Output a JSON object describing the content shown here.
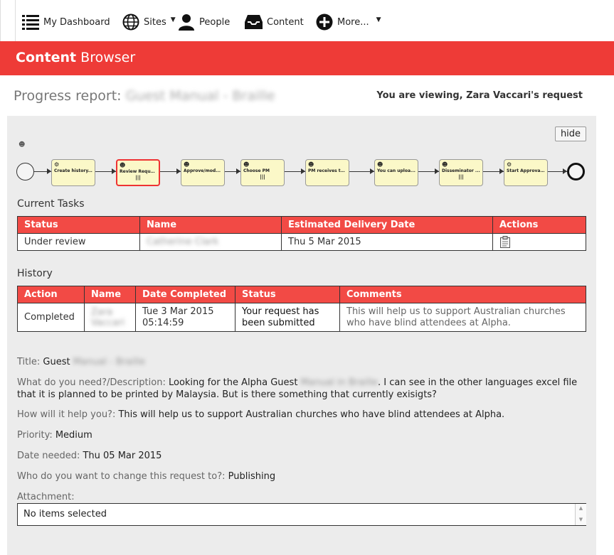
{
  "nav": {
    "dashboard": "My Dashboard",
    "sites": "Sites",
    "people": "People",
    "content": "Content",
    "more": "More..."
  },
  "header": {
    "title_bold": "Content",
    "title_rest": "Browser"
  },
  "page": {
    "progress_label": "Progress report:",
    "progress_name": "Guest Manual - Braille",
    "viewing": "You are viewing, Zara Vaccari's request",
    "hide_label": "hide"
  },
  "workflow": {
    "steps": [
      {
        "label": "Create history...",
        "icon": "gear-icon"
      },
      {
        "label": "Review Reque...",
        "icon": "user-icon"
      },
      {
        "label": "Approve/mod...",
        "icon": "user-icon"
      },
      {
        "label": "Choose PM",
        "icon": "user-icon"
      },
      {
        "label": "PM receives ta...",
        "icon": "user-icon"
      },
      {
        "label": "You can uploa...",
        "icon": "user-icon"
      },
      {
        "label": "Disseminator ...",
        "icon": "user-icon"
      },
      {
        "label": "Start Approval...",
        "icon": "gear-icon"
      }
    ],
    "active_index": 1
  },
  "current_tasks": {
    "title": "Current Tasks",
    "headers": [
      "Status",
      "Name",
      "Estimated Delivery Date",
      "Actions"
    ],
    "rows": [
      {
        "status": "Under review",
        "name": "Catherine Clark",
        "date": "Thu 5 Mar 2015",
        "action_icon": "clipboard-icon"
      }
    ]
  },
  "history": {
    "title": "History",
    "headers": [
      "Action",
      "Name",
      "Date Completed",
      "Status",
      "Comments"
    ],
    "rows": [
      {
        "action": "Completed",
        "name": "Zara Vaccari",
        "date": "Tue 3 Mar 2015 05:14:59",
        "status": "Your request has been submitted",
        "comments": "This will help us to support Australian churches who have blind attendees at Alpha."
      }
    ]
  },
  "details": {
    "title_label": "Title:",
    "title_value_a": "Guest",
    "title_value_b": "Manual - Braille",
    "need_label": "What do you need?/Description:",
    "need_value_a": "Looking for the Alpha Guest",
    "need_value_b": "Manual in Braille",
    "need_value_c": ". I can see in the other languages excel file that it is planned to be printed by Malaysia. But is there something that currently exisigts?",
    "help_label": "How will it help you?:",
    "help_value": "This will help us to support Australian churches who have blind attendees at Alpha.",
    "priority_label": "Priority:",
    "priority_value": "Medium",
    "date_label": "Date needed:",
    "date_value": "Thu 05 Mar 2015",
    "change_label": "Who do you want to change this request to?:",
    "change_value": "Publishing",
    "attachment_label": "Attachment:",
    "attachment_value": "No items selected"
  },
  "colors": {
    "brand_red": "#ee3b37",
    "table_header": "#f24a45",
    "active_step": "#e33333"
  }
}
